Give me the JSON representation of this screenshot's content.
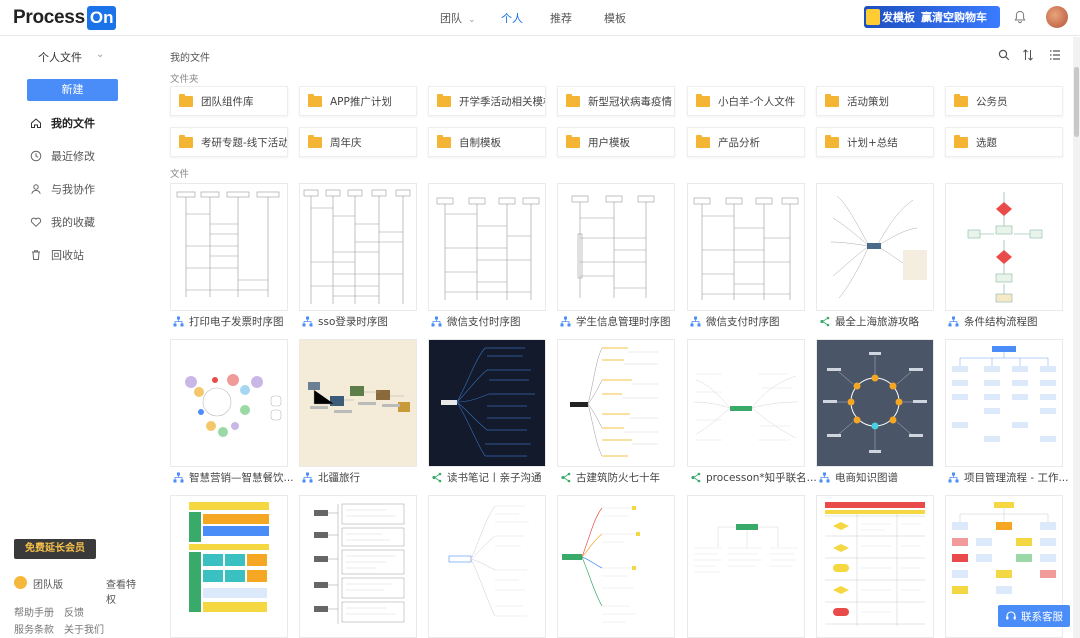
{
  "header": {
    "logo_text": "Process",
    "logo_badge": "On",
    "nav": [
      {
        "label": "团队",
        "has_dropdown": true
      },
      {
        "label": "个人",
        "active": true
      },
      {
        "label": "推荐"
      },
      {
        "label": "模板"
      }
    ],
    "promo": {
      "label1": "发模板",
      "label2": "赢清空购物车"
    },
    "bell_icon": "bell-icon",
    "avatar_icon": "user-avatar"
  },
  "sidebar": {
    "title": "个人文件",
    "new_button": "新建",
    "items": [
      {
        "label": "我的文件",
        "icon": "home-icon",
        "active": true
      },
      {
        "label": "最近修改",
        "icon": "clock-icon"
      },
      {
        "label": "与我协作",
        "icon": "share-user-icon"
      },
      {
        "label": "我的收藏",
        "icon": "heart-icon"
      },
      {
        "label": "回收站",
        "icon": "trash-icon"
      }
    ],
    "vip_button": "免费延长会员",
    "team_label": "团队版",
    "team_link": "查看特权",
    "footer": [
      "帮助手册",
      "反馈",
      "服务条款",
      "关于我们"
    ]
  },
  "main": {
    "breadcrumb": "我的文件",
    "folder_section": "文件夹",
    "file_section": "文件",
    "folders": [
      "团队组件库",
      "APP推广计划",
      "开学季活动相关模板",
      "新型冠状病毒疫情",
      "小白羊-个人文件",
      "活动策划",
      "公务员",
      "考研专题-线下活动",
      "周年庆",
      "自制模板",
      "用户模板",
      "产品分析",
      "计划+总结",
      "选题"
    ],
    "files": [
      {
        "name": "打印电子发票时序图",
        "type": "flow"
      },
      {
        "name": "sso登录时序图",
        "type": "flow"
      },
      {
        "name": "微信支付时序图",
        "type": "flow"
      },
      {
        "name": "学生信息管理时序图",
        "type": "flow"
      },
      {
        "name": "微信支付时序图",
        "type": "flow"
      },
      {
        "name": "最全上海旅游攻略",
        "type": "mind"
      },
      {
        "name": "条件结构流程图",
        "type": "flow"
      },
      {
        "name": "智慧营销—智慧餐饮...",
        "type": "flow"
      },
      {
        "name": "北疆旅行",
        "type": "flow"
      },
      {
        "name": "读书笔记丨亲子沟通",
        "type": "mind"
      },
      {
        "name": "古建筑防火七十年",
        "type": "mind"
      },
      {
        "name": "processon*知乎联名...",
        "type": "mind"
      },
      {
        "name": "电商知识图谱",
        "type": "flow"
      },
      {
        "name": "项目管理流程 - 工作...",
        "type": "flow"
      }
    ],
    "contact_button": "联系客服"
  },
  "colors": {
    "accent": "#4a8df8",
    "folder": "#f4b534",
    "vip_bg": "#3a3a3a",
    "vip_text": "#f5c04a"
  }
}
